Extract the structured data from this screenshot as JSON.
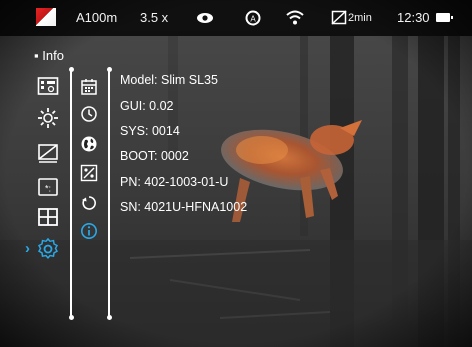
{
  "status_bar": {
    "mode": "A100m",
    "zoom": "3.5 x",
    "timer": "2min",
    "clock": "12:30",
    "icons": [
      "color-palette-icon",
      "eye-icon",
      "gear-autocal-icon",
      "wifi-icon",
      "no-display-timer-icon",
      "battery-icon"
    ]
  },
  "menu": {
    "title": "Info",
    "items": [
      {
        "name": "film-settings-icon"
      },
      {
        "name": "brightness-icon"
      },
      {
        "name": "display-off-icon"
      },
      {
        "name": "image-settings-icon"
      },
      {
        "name": "grid-icon"
      },
      {
        "name": "settings-gear-icon",
        "active": true
      }
    ],
    "sub_items": [
      {
        "name": "calendar-icon"
      },
      {
        "name": "clock-icon"
      },
      {
        "name": "globe-icon"
      },
      {
        "name": "percent-icon"
      },
      {
        "name": "reset-icon"
      },
      {
        "name": "info-icon",
        "active": true
      }
    ]
  },
  "device_info": {
    "model": "Model:  Slim SL35",
    "gui": "GUI:  0.02",
    "sys": "SYS:  0014",
    "boot": "BOOT:  0002",
    "pn": "PN:  402-1003-01-U",
    "sn": "SN:  4021U-HFNA1002"
  },
  "colors": {
    "accent": "#2aa9e8",
    "palette_red": "#e52424",
    "text": "#ffffff"
  }
}
